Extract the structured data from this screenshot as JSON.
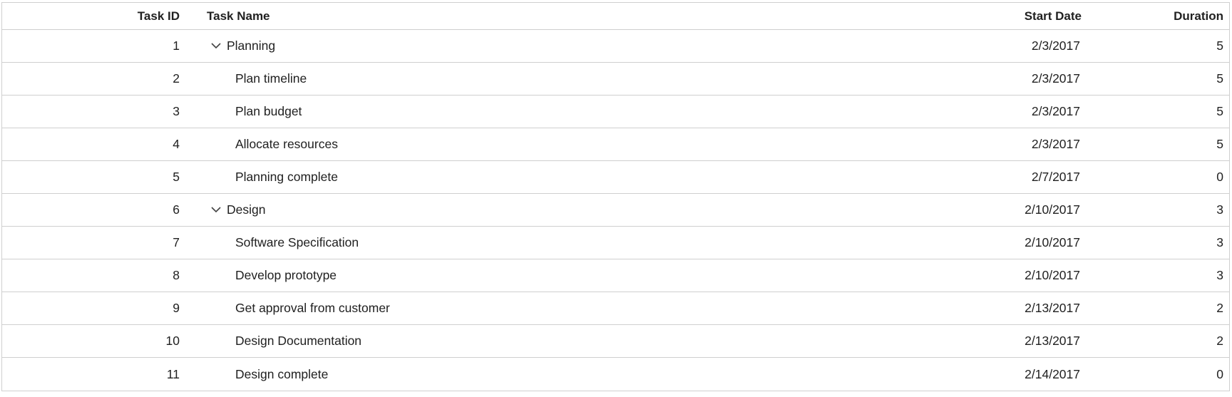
{
  "columns": {
    "task_id": "Task ID",
    "task_name": "Task Name",
    "start_date": "Start Date",
    "duration": "Duration"
  },
  "rows": [
    {
      "id": "1",
      "name": "Planning",
      "start": "2/3/2017",
      "duration": "5",
      "parent": true,
      "expanded": true
    },
    {
      "id": "2",
      "name": "Plan timeline",
      "start": "2/3/2017",
      "duration": "5",
      "parent": false
    },
    {
      "id": "3",
      "name": "Plan budget",
      "start": "2/3/2017",
      "duration": "5",
      "parent": false
    },
    {
      "id": "4",
      "name": "Allocate resources",
      "start": "2/3/2017",
      "duration": "5",
      "parent": false
    },
    {
      "id": "5",
      "name": "Planning complete",
      "start": "2/7/2017",
      "duration": "0",
      "parent": false
    },
    {
      "id": "6",
      "name": "Design",
      "start": "2/10/2017",
      "duration": "3",
      "parent": true,
      "expanded": true
    },
    {
      "id": "7",
      "name": "Software Specification",
      "start": "2/10/2017",
      "duration": "3",
      "parent": false
    },
    {
      "id": "8",
      "name": "Develop prototype",
      "start": "2/10/2017",
      "duration": "3",
      "parent": false
    },
    {
      "id": "9",
      "name": "Get approval from customer",
      "start": "2/13/2017",
      "duration": "2",
      "parent": false
    },
    {
      "id": "10",
      "name": "Design Documentation",
      "start": "2/13/2017",
      "duration": "2",
      "parent": false
    },
    {
      "id": "11",
      "name": "Design complete",
      "start": "2/14/2017",
      "duration": "0",
      "parent": false
    }
  ],
  "icons": {
    "expander": "chevron-down-icon"
  },
  "colors": {
    "border": "#cfcfcf",
    "text": "#212121",
    "background": "#ffffff"
  }
}
